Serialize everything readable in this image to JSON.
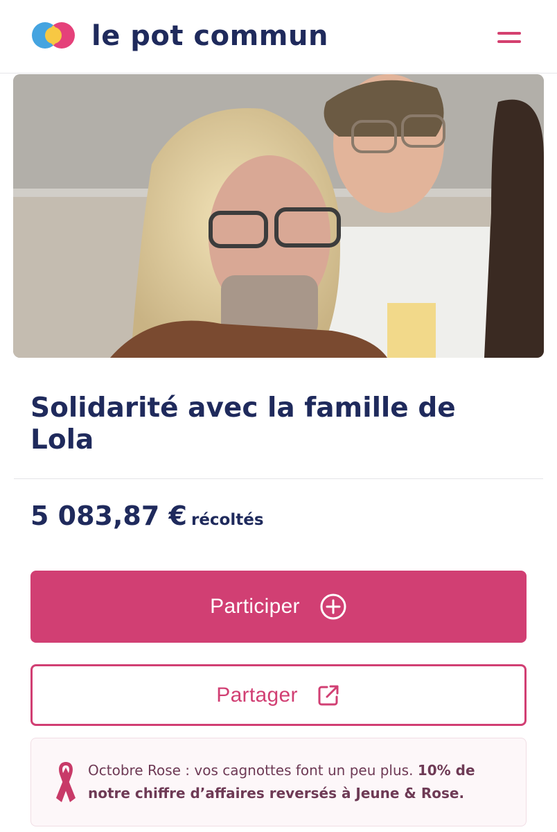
{
  "header": {
    "brand": "le pot commun",
    "logo_icon": "overlapping-circles-logo",
    "menu_icon": "hamburger-menu-icon",
    "colors": {
      "brand_blue": "#1f2a5c",
      "brand_pink": "#d4406f",
      "logo_yellow": "#f7c843",
      "logo_blue": "#45a4e0"
    }
  },
  "hero": {
    "alt": "photo"
  },
  "campaign": {
    "title": "Solidarité avec la famille de Lola",
    "amount": "5 083,87 €",
    "amount_suffix": "récoltés"
  },
  "actions": {
    "participate_label": "Participer",
    "participate_icon": "plus-circle-icon",
    "share_label": "Partager",
    "share_icon": "external-link-icon",
    "accent_color": "#d13f73"
  },
  "notice": {
    "icon": "pink-ribbon-icon",
    "text_part1": "Octobre Rose : vos cagnottes font un peu plus. ",
    "text_part2": "10% de notre chiffre d’affaires reversés à Jeune & Rose."
  }
}
